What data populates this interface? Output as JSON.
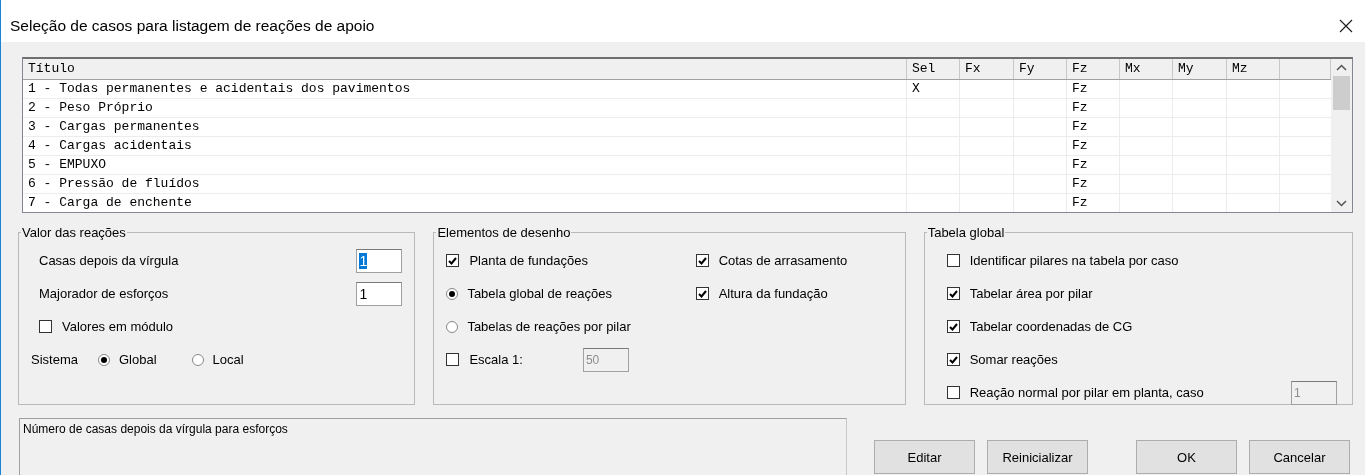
{
  "window": {
    "title": "Seleção de casos para listagem de reações de apoio"
  },
  "table": {
    "columns": [
      "Título",
      "Sel",
      "Fx",
      "Fy",
      "Fz",
      "Mx",
      "My",
      "Mz"
    ],
    "rows": [
      {
        "title": "1 - Todas permanentes e acidentais dos pavimentos",
        "sel": "X",
        "fz": "Fz"
      },
      {
        "title": "2 - Peso Próprio",
        "fz": "Fz"
      },
      {
        "title": "3 - Cargas permanentes",
        "fz": "Fz"
      },
      {
        "title": "4 - Cargas acidentais",
        "fz": "Fz"
      },
      {
        "title": "5 - EMPUXO",
        "fz": "Fz"
      },
      {
        "title": "6 - Pressão de fluídos",
        "fz": "Fz"
      },
      {
        "title": "7 - Carga de enchente",
        "fz": "Fz"
      }
    ]
  },
  "valor": {
    "title": "Valor das reações",
    "fields": [
      {
        "label": "Casas depois da vírgula",
        "value": "1",
        "highlighted": true
      },
      {
        "label": "Majorador de esforços",
        "value": "1",
        "highlighted": false
      }
    ],
    "checkbox": {
      "label": "Valores em módulo",
      "checked": false
    },
    "sistema": {
      "label": "Sistema",
      "options": [
        {
          "label": "Global",
          "selected": true
        },
        {
          "label": "Local",
          "selected": false
        }
      ]
    }
  },
  "elementos": {
    "title": "Elementos de desenho",
    "left": [
      {
        "kind": "checkbox",
        "label": "Planta de fundações",
        "checked": true
      },
      {
        "kind": "radio",
        "label": "Tabela global de reações",
        "selected": true
      },
      {
        "kind": "radio",
        "label": "Tabelas de reações por pilar",
        "selected": false
      },
      {
        "kind": "checkbox",
        "label": "Escala 1:",
        "checked": false,
        "field": {
          "value": "50",
          "disabled": true
        }
      }
    ],
    "right": [
      {
        "kind": "checkbox",
        "label": "Cotas de arrasamento",
        "checked": true
      },
      {
        "kind": "checkbox",
        "label": "Altura da fundação",
        "checked": true
      }
    ]
  },
  "tabela": {
    "title": "Tabela global",
    "items": [
      {
        "kind": "checkbox",
        "label": "Identificar pilares na tabela por caso",
        "checked": false
      },
      {
        "kind": "checkbox",
        "label": "Tabelar área por pilar",
        "checked": true
      },
      {
        "kind": "checkbox",
        "label": "Tabelar coordenadas de CG",
        "checked": true
      },
      {
        "kind": "checkbox",
        "label": "Somar reações",
        "checked": true
      },
      {
        "kind": "checkbox",
        "label": "Reação normal  por pilar em planta, caso",
        "checked": false,
        "field": {
          "value": "1",
          "disabled": true
        }
      }
    ]
  },
  "status": "Número de casas depois da vírgula para esforços",
  "buttons": [
    "Editar",
    "Reinicializar",
    "OK",
    "Cancelar"
  ]
}
